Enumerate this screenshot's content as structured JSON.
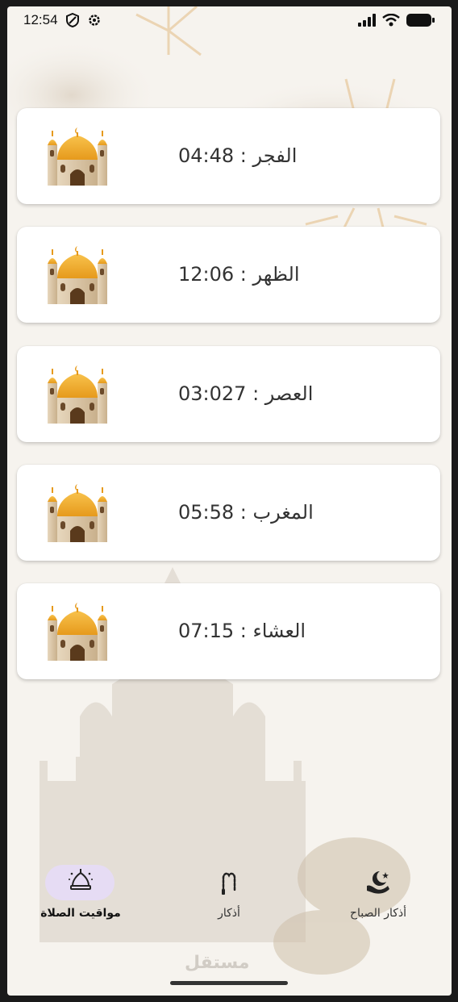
{
  "status_bar": {
    "time": "12:54",
    "icons": [
      "shield-icon",
      "settings-gear-icon",
      "cell-signal-icon",
      "wifi-icon",
      "battery-icon"
    ]
  },
  "prayers": [
    {
      "label": "الفجر : 04:48",
      "icon": "mosque-icon"
    },
    {
      "label": "الظهر : 12:06",
      "icon": "mosque-icon"
    },
    {
      "label": "العصر : 03:027",
      "icon": "mosque-icon"
    },
    {
      "label": "المغرب : 05:58",
      "icon": "mosque-icon"
    },
    {
      "label": "العشاء : 07:15",
      "icon": "mosque-icon"
    }
  ],
  "bottom_nav": [
    {
      "label": "مواقيت الصلاة",
      "icon": "mosque-dome-icon",
      "active": true
    },
    {
      "label": "أذكار",
      "icon": "prayer-beads-icon",
      "active": false
    },
    {
      "label": "أذكار الصباح",
      "icon": "moon-hands-icon",
      "active": false
    }
  ],
  "watermark": "مستقل",
  "colors": {
    "background": "#f6f3ee",
    "card": "#ffffff",
    "active_pill": "#e6dcf4",
    "text": "#333333"
  }
}
